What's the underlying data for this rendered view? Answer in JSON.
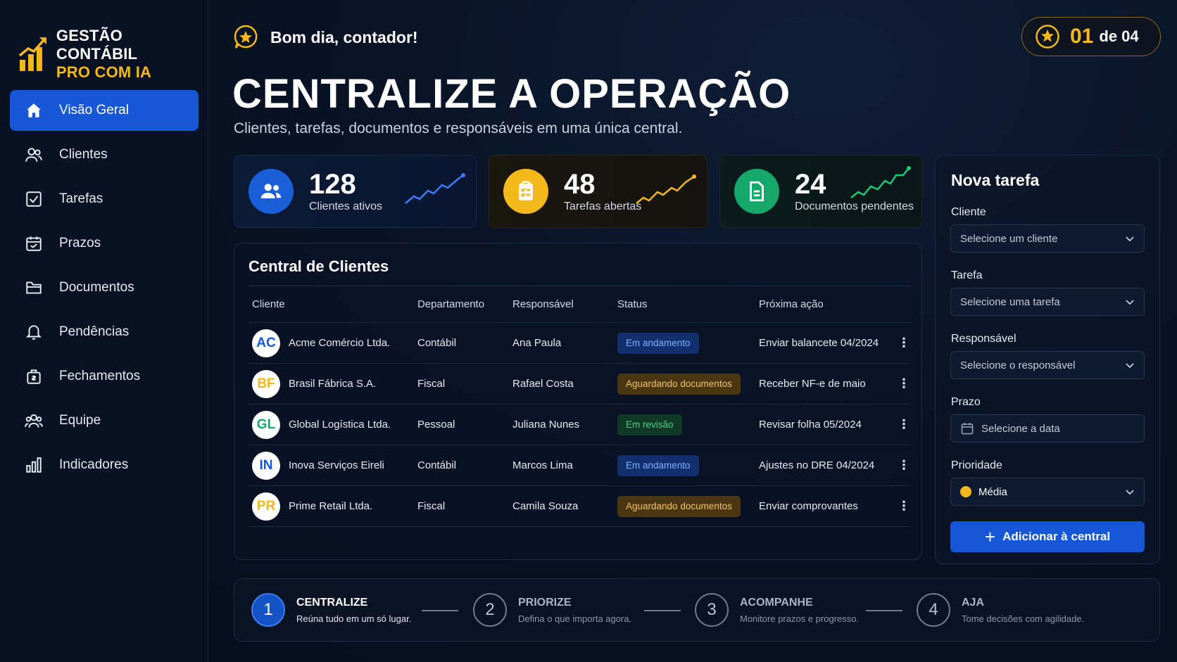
{
  "brand": {
    "line1": "GESTÃO CONTÁBIL",
    "line2": "PRO COM IA"
  },
  "nav": [
    {
      "label": "Visão Geral",
      "icon": "home-icon",
      "active": true
    },
    {
      "label": "Clientes",
      "icon": "users-icon"
    },
    {
      "label": "Tarefas",
      "icon": "checkbox-icon"
    },
    {
      "label": "Prazos",
      "icon": "calendar-icon"
    },
    {
      "label": "Documentos",
      "icon": "folder-icon"
    },
    {
      "label": "Pendências",
      "icon": "bell-icon"
    },
    {
      "label": "Fechamentos",
      "icon": "briefcase-icon"
    },
    {
      "label": "Equipe",
      "icon": "team-icon"
    },
    {
      "label": "Indicadores",
      "icon": "bar-chart-icon"
    }
  ],
  "header": {
    "greeting": "Bom dia, contador!",
    "step_current": "01",
    "step_of": "de 04",
    "title": "CENTRALIZE A OPERAÇÃO",
    "subtitle": "Clientes, tarefas, documentos e responsáveis em uma única central."
  },
  "stats": [
    {
      "value": "128",
      "label": "Clientes ativos",
      "color": "#1a5ed8",
      "trend_color": "#3a7bff"
    },
    {
      "value": "48",
      "label": "Tarefas abertas",
      "color": "#f4b81a",
      "trend_color": "#f4b81a"
    },
    {
      "value": "24",
      "label": "Documentos pendentes",
      "color": "#14a86a",
      "trend_color": "#1fc77a"
    }
  ],
  "table": {
    "title": "Central de Clientes",
    "columns": [
      "Cliente",
      "Departamento",
      "Responsável",
      "Status",
      "Próxima ação"
    ],
    "rows": [
      {
        "initials": "AC",
        "color": "#1557d6",
        "client": "Acme Comércio Ltda.",
        "dept": "Contábil",
        "resp": "Ana Paula",
        "status": "Em andamento",
        "status_type": "progress",
        "next": "Enviar balancete 04/2024"
      },
      {
        "initials": "BF",
        "color": "#f4b81a",
        "client": "Brasil Fábrica S.A.",
        "dept": "Fiscal",
        "resp": "Rafael Costa",
        "status": "Aguardando documentos",
        "status_type": "waiting",
        "next": "Receber NF-e de maio"
      },
      {
        "initials": "GL",
        "color": "#14a86a",
        "client": "Global Logística Ltda.",
        "dept": "Pessoal",
        "resp": "Juliana Nunes",
        "status": "Em revisão",
        "status_type": "review",
        "next": "Revisar folha 05/2024"
      },
      {
        "initials": "IN",
        "color": "#1557d6",
        "client": "Inova Serviços Eireli",
        "dept": "Contábil",
        "resp": "Marcos Lima",
        "status": "Em andamento",
        "status_type": "progress",
        "next": "Ajustes no DRE 04/2024"
      },
      {
        "initials": "PR",
        "color": "#f4b81a",
        "client": "Prime Retail Ltda.",
        "dept": "Fiscal",
        "resp": "Camila Souza",
        "status": "Aguardando documentos",
        "status_type": "waiting",
        "next": "Enviar comprovantes"
      }
    ]
  },
  "form": {
    "title": "Nova tarefa",
    "cliente_label": "Cliente",
    "cliente_placeholder": "Selecione um cliente",
    "tarefa_label": "Tarefa",
    "tarefa_placeholder": "Selecione uma tarefa",
    "resp_label": "Responsável",
    "resp_placeholder": "Selecione o responsável",
    "prazo_label": "Prazo",
    "prazo_placeholder": "Selecione a data",
    "prioridade_label": "Prioridade",
    "prioridade_value": "Média",
    "submit_label": "Adicionar à central"
  },
  "steps": [
    {
      "num": "1",
      "title": "CENTRALIZE",
      "desc": "Reúna tudo em um só lugar.",
      "active": true
    },
    {
      "num": "2",
      "title": "PRIORIZE",
      "desc": "Defina o que importa agora."
    },
    {
      "num": "3",
      "title": "ACOMPANHE",
      "desc": "Monitore prazos e progresso."
    },
    {
      "num": "4",
      "title": "AJA",
      "desc": "Tome decisões com agilidade."
    }
  ]
}
